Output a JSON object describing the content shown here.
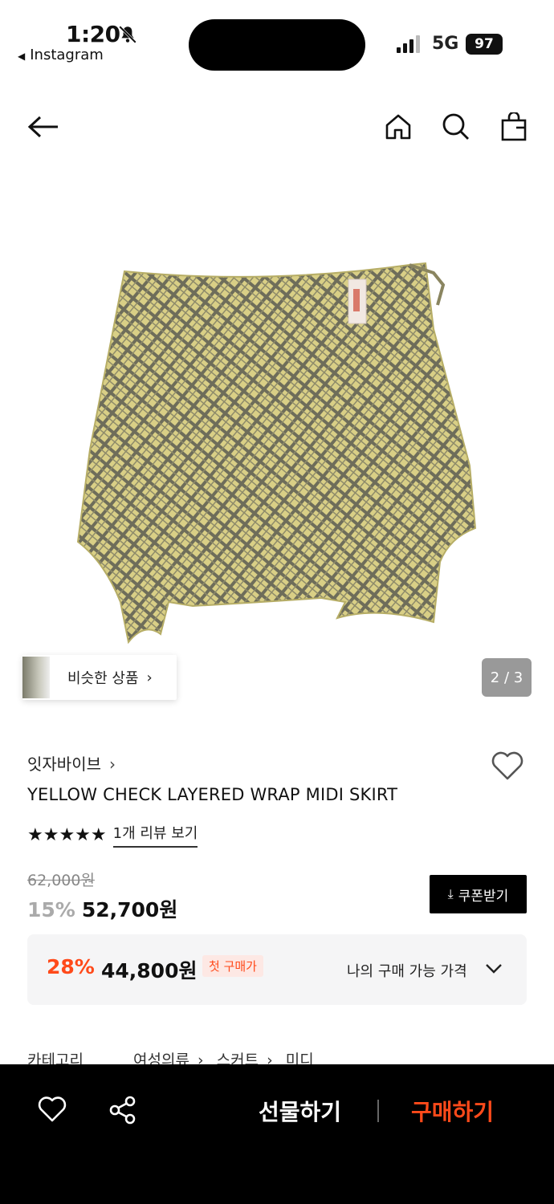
{
  "status_bar": {
    "time": "1:20",
    "back_app": "Instagram",
    "network": "5G",
    "battery": "97"
  },
  "header": {
    "icons": [
      "back-arrow-icon",
      "home-icon",
      "search-icon",
      "shopping-bag-icon"
    ]
  },
  "gallery": {
    "similar_label": "비슷한 상품",
    "page_indicator": "2 / 3"
  },
  "product": {
    "brand": "잇자바이브",
    "title": "YELLOW CHECK LAYERED WRAP MIDI SKIRT",
    "stars": "★★★★★",
    "review_link": "1개 리뷰 보기",
    "original_price": "62,000원",
    "discount": "15%",
    "price": "52,700원",
    "coupon_label": "쿠폰받기",
    "best": {
      "discount": "28%",
      "price": "44,800원",
      "badge": "첫 구매가",
      "my_price_label": "나의 구매 가능 가격"
    },
    "category": {
      "label": "카테고리",
      "path": [
        "여성의류",
        "스커트",
        "미디"
      ]
    }
  },
  "bottom_bar": {
    "gift_label": "선물하기",
    "buy_label": "구매하기"
  },
  "colors": {
    "accent": "#ff4a1a",
    "bar_bg": "#000000"
  }
}
